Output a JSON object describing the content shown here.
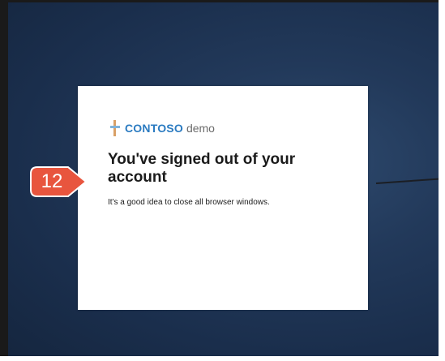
{
  "brand": {
    "name": "CONTOSO",
    "suffix": "demo",
    "accent_color": "#2b7bc1"
  },
  "dialog": {
    "title": "You've signed out of your account",
    "message": "It's a good idea to close all browser windows."
  },
  "annotation": {
    "step_number": "12",
    "badge_color": "#e8553e"
  }
}
